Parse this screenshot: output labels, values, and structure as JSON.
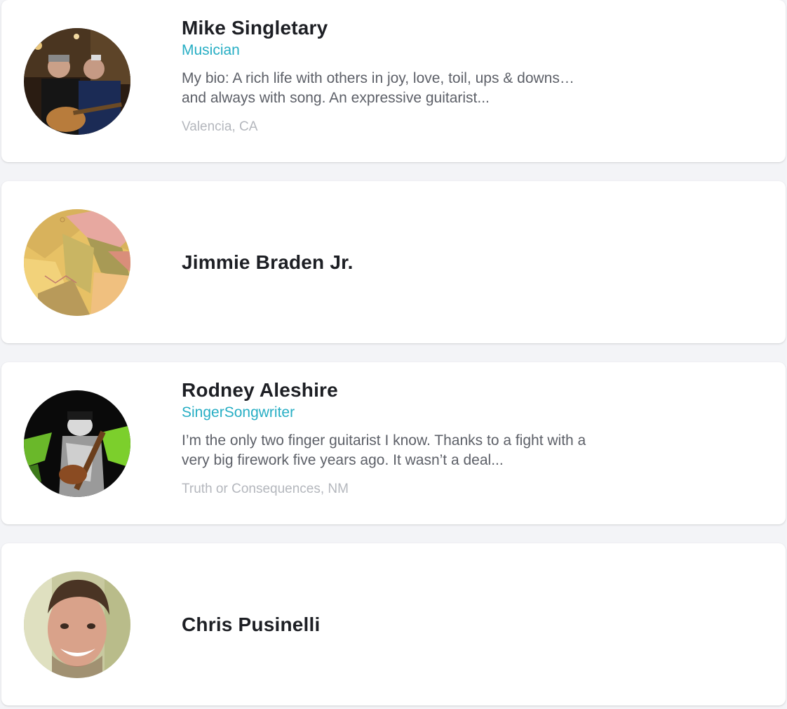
{
  "musicians": [
    {
      "name": "Mike Singletary",
      "role": "Musician",
      "bio": "My bio: A rich life with others in joy, love, toil, ups & downs… and always with song. An expressive guitarist...",
      "location": "Valencia, CA"
    },
    {
      "name": "Jimmie Braden Jr."
    },
    {
      "name": "Rodney Aleshire",
      "role": "SingerSongwriter",
      "bio": "I’m the only two finger guitarist I know. Thanks to a fight with a very big firework five years ago. It wasn’t a deal...",
      "location": "Truth or Consequences, NM"
    },
    {
      "name": "Chris Pusinelli"
    }
  ],
  "colors": {
    "accent": "#27aec4",
    "name": "#1d1f24",
    "bio": "#5d6068",
    "location": "#b4b7bd",
    "background": "#f3f4f7",
    "card": "#ffffff"
  }
}
